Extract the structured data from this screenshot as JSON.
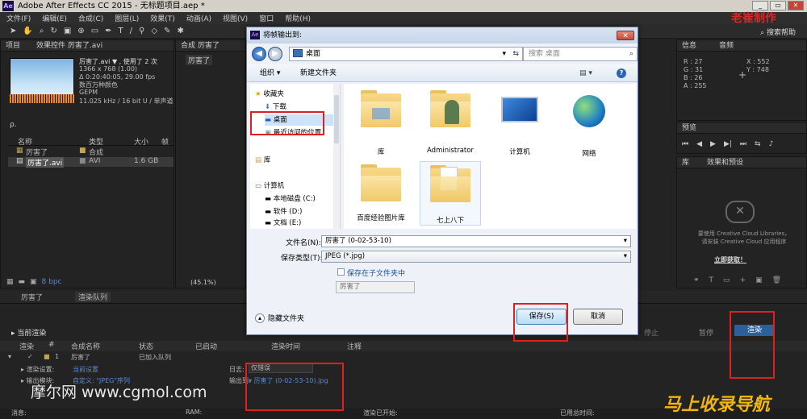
{
  "app": {
    "title": "Adobe After Effects CC 2015 - 无标题项目.aep *",
    "logo": "Ae",
    "brand": "老崔制作"
  },
  "menu": [
    "文件(F)",
    "编辑(E)",
    "合成(C)",
    "图层(L)",
    "效果(T)",
    "动画(A)",
    "视图(V)",
    "窗口",
    "帮助(H)"
  ],
  "toolbar": {
    "search_help": "搜索帮助"
  },
  "project": {
    "tab_project": "项目",
    "tab_effects": "效果控件 厉害了.avi",
    "file_name": "厉害了.avi ▼ , 使用了 2 次",
    "res": "1366 x 768 (1.00)",
    "duration": "Δ 0:20:40:05, 29.00 fps",
    "colors": "数百万种颜色",
    "codec": "GEPM",
    "audio": "11.025 kHz / 16 bit U / 单声道",
    "search": "ρ.",
    "columns": {
      "name": "名称",
      "type": "类型",
      "size": "大小",
      "frame": "帧"
    },
    "rows": [
      {
        "name": "厉害了",
        "type": "合成",
        "size": ""
      },
      {
        "name": "厉害了.avi",
        "type": "AVI",
        "size": "1.6 GB"
      }
    ],
    "bpc": "8 bpc"
  },
  "comp": {
    "tab": "合成 厉害了",
    "subtab": "厉害了",
    "zoom": "(45.1%)"
  },
  "info": {
    "tab_info": "信息",
    "tab_audio": "音频",
    "r": "R : 27",
    "g": "G : 31",
    "b": "B : 26",
    "a": "A : 255",
    "x": "X : 552",
    "y": "Y : 748"
  },
  "preview": {
    "tab": "预览"
  },
  "library": {
    "tab": "库",
    "tab_effects": "效果和预设",
    "msg1": "要使用 Creative Cloud Libraries，",
    "msg2": "请安装 Creative Cloud 应用程序",
    "link": "立即获取！"
  },
  "render": {
    "tab1": "厉害了",
    "tab2": "渲染队列",
    "current": "当前渲染",
    "stop": "停止",
    "pause": "暂停",
    "render_btn": "渲染",
    "cols": {
      "render": "渲染",
      "num": "#",
      "comp": "合成名称",
      "status": "状态",
      "started": "已启动",
      "time": "渲染时间",
      "comment": "注释"
    },
    "item": {
      "num": "1",
      "comp": "厉害了",
      "status": "已加入队列"
    },
    "settings_label": "渲染设置:",
    "settings_val": "当前设置",
    "output_label": "输出模块:",
    "output_val": "自定义: \"JPEG\"序列",
    "log_label": "日志:",
    "log_val": "仅错误",
    "output_to": "输出到:",
    "output_file": "厉害了 (0-02-53-10).jpg",
    "status_msg": "消息:",
    "ram": "RAM:",
    "render_started": "渲染已开始:",
    "elapsed": "已用总时间:"
  },
  "dialog": {
    "title": "将帧输出到:",
    "address": "桌面",
    "search": "搜索 桌面",
    "organize": "组织 ▾",
    "new_folder": "新建文件夹",
    "nav": {
      "favorites": "收藏夹",
      "downloads": "下载",
      "desktop": "桌面",
      "recent": "最近访问的位置",
      "libraries": "库",
      "computer": "计算机",
      "local_disk": "本地磁盘 (C:)",
      "software": "软件 (D:)",
      "docs": "文档 (E:)"
    },
    "items": [
      "库",
      "Administrator",
      "计算机",
      "网络",
      "百度经验图片库",
      "七上八下"
    ],
    "filename_label": "文件名(N):",
    "filename": "厉害了 (0-02-53-10)",
    "filetype_label": "保存类型(T):",
    "filetype": "JPEG (*.jpg)",
    "subfolder": "保存在子文件夹中",
    "subfolder_name": "厉害了",
    "hide": "隐藏文件夹",
    "save": "保存(S)",
    "cancel": "取消"
  },
  "watermarks": {
    "left": "摩尔网 www.cgmol.com",
    "right": "马上收录导航"
  }
}
